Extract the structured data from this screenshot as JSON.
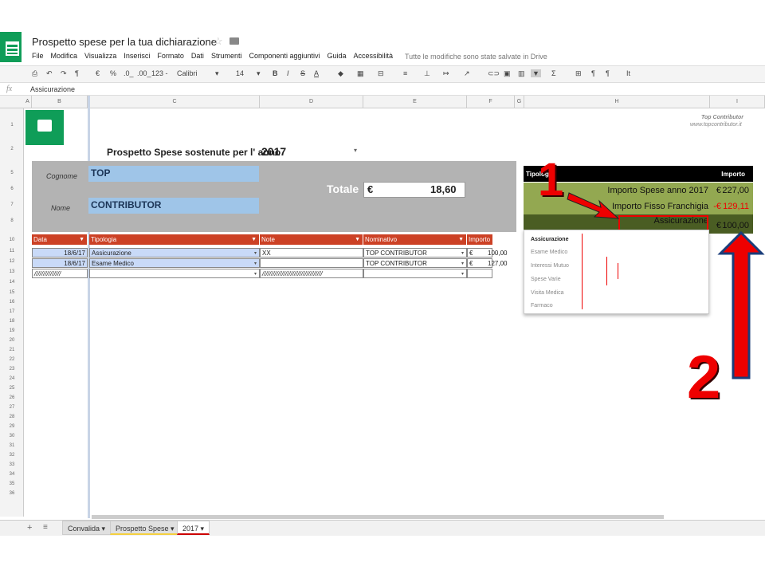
{
  "app": {
    "title": "Prospetto spese per la tua dichiarazione",
    "menu": [
      "File",
      "Modifica",
      "Visualizza",
      "Inserisci",
      "Formato",
      "Dati",
      "Strumenti",
      "Componenti aggiuntivi",
      "Guida",
      "Accessibilità"
    ],
    "saved_status": "Tutte le modifiche sono state salvate in Drive"
  },
  "toolbar": {
    "currency": "€",
    "percent": "%",
    "dec_less": ".0_",
    ".dec_more": ".00_",
    "format": "123 -",
    "font": "Calibri",
    "font_size": "14"
  },
  "formula": {
    "fx": "fx",
    "value": "Assicurazione"
  },
  "columns": [
    "A",
    "B",
    "C",
    "D",
    "E",
    "F",
    "G",
    "H",
    "I"
  ],
  "rows": [
    "1",
    "2",
    "5",
    "6",
    "7",
    "8",
    "10",
    "11",
    "12",
    "13",
    "14",
    "15",
    "16",
    "17",
    "18",
    "19",
    "20",
    "21",
    "22",
    "23",
    "24",
    "25",
    "26",
    "27",
    "28",
    "29",
    "30",
    "31",
    "32",
    "33",
    "34",
    "35",
    "36"
  ],
  "brand": {
    "line1": "Top Contributor",
    "line2": "www.topcontributor.it"
  },
  "header": {
    "title": "Prospetto Spese sostenute per l' anno",
    "year": "2017"
  },
  "form": {
    "cognome_label": "Cognome",
    "cognome": "TOP",
    "nome_label": "Nome",
    "nome": "CONTRIBUTOR",
    "totale_label": "Totale",
    "currency": "€",
    "totale": "18,60"
  },
  "table": {
    "headers": [
      "Data",
      "Tipologia",
      "Note",
      "Nominativo",
      "Importo"
    ],
    "rows": [
      {
        "data": "18/6/17",
        "tipologia": "Assicurazione",
        "note": "XX",
        "nominativo": "TOP CONTRIBUTOR",
        "eur": "€",
        "importo": "100,00"
      },
      {
        "data": "18/6/17",
        "tipologia": "Esame Medico",
        "note": "",
        "nominativo": "TOP CONTRIBUTOR",
        "eur": "€",
        "importo": "127,00"
      }
    ],
    "empty_data": "///////////////",
    "empty_note": "//////////////////////////////////"
  },
  "summary": {
    "h1": "Tipologia",
    "h2": "Importo",
    "r1_label": "Importo Spese anno 2017",
    "r1_eur": "€",
    "r1_val": "227,00",
    "r2_label": "Importo Fisso Franchigia",
    "r2_eur": "-€",
    "r2_val": "129,11",
    "r3_label": "Assicurazione",
    "r3_eur": "€",
    "r3_val": "100,00"
  },
  "dropdown": [
    "Assicurazione",
    "Esame Medico",
    "Interessi Mutuo",
    "Spese Varie",
    "Visita Medica",
    "Farmaco"
  ],
  "annotations": {
    "one": "1",
    "two": "2"
  },
  "tabs": [
    "Convalida",
    "Prospetto Spese",
    "2017"
  ],
  "colors": {
    "accent_red": "#e00000",
    "header_red": "#cc4125",
    "olive": "#6b8e23",
    "blue_cell": "#9fc5e8",
    "sheets_green": "#0f9d58"
  }
}
